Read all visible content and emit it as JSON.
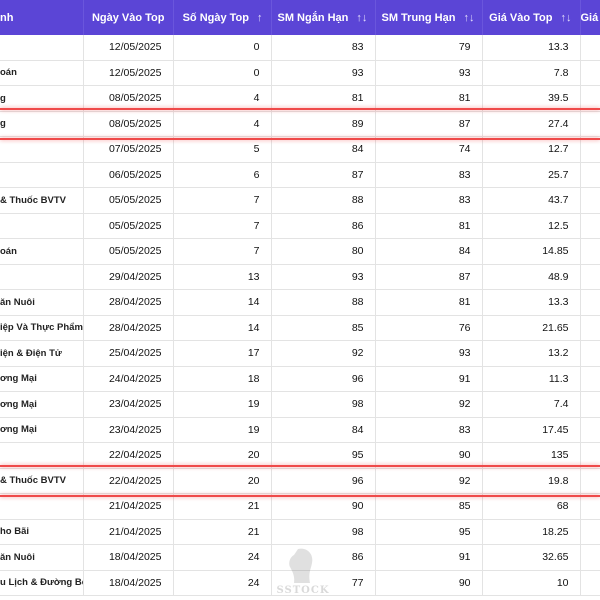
{
  "columns": [
    {
      "label": "nh",
      "sort_icon": ""
    },
    {
      "label": "Ngày Vào Top",
      "sort_icon": ""
    },
    {
      "label": "Số Ngày Top",
      "sort_icon": "↑"
    },
    {
      "label": "SM Ngắn Hạn",
      "sort_icon": "↑↓"
    },
    {
      "label": "SM Trung Hạn",
      "sort_icon": "↑↓"
    },
    {
      "label": "Giá Vào Top",
      "sort_icon": "↑↓"
    },
    {
      "label": "Giá",
      "sort_icon": ""
    }
  ],
  "rows": [
    {
      "industry": "",
      "date": "12/05/2025",
      "days": "0",
      "sm_short": "83",
      "sm_mid": "79",
      "price": "13.3",
      "extra": ""
    },
    {
      "industry": "oán",
      "date": "12/05/2025",
      "days": "0",
      "sm_short": "93",
      "sm_mid": "93",
      "price": "7.8",
      "extra": ""
    },
    {
      "industry": "g",
      "date": "08/05/2025",
      "days": "4",
      "sm_short": "81",
      "sm_mid": "81",
      "price": "39.5",
      "extra": ""
    },
    {
      "industry": "g",
      "date": "08/05/2025",
      "days": "4",
      "sm_short": "89",
      "sm_mid": "87",
      "price": "27.4",
      "extra": ""
    },
    {
      "industry": "",
      "date": "07/05/2025",
      "days": "5",
      "sm_short": "84",
      "sm_mid": "74",
      "price": "12.7",
      "extra": ""
    },
    {
      "industry": "",
      "date": "06/05/2025",
      "days": "6",
      "sm_short": "87",
      "sm_mid": "83",
      "price": "25.7",
      "extra": ""
    },
    {
      "industry": "& Thuốc BVTV",
      "date": "05/05/2025",
      "days": "7",
      "sm_short": "88",
      "sm_mid": "83",
      "price": "43.7",
      "extra": ""
    },
    {
      "industry": "",
      "date": "05/05/2025",
      "days": "7",
      "sm_short": "86",
      "sm_mid": "81",
      "price": "12.5",
      "extra": ""
    },
    {
      "industry": "oán",
      "date": "05/05/2025",
      "days": "7",
      "sm_short": "80",
      "sm_mid": "84",
      "price": "14.85",
      "extra": ""
    },
    {
      "industry": "",
      "date": "29/04/2025",
      "days": "13",
      "sm_short": "93",
      "sm_mid": "87",
      "price": "48.9",
      "extra": ""
    },
    {
      "industry": "ăn Nuôi",
      "date": "28/04/2025",
      "days": "14",
      "sm_short": "88",
      "sm_mid": "81",
      "price": "13.3",
      "extra": ""
    },
    {
      "industry": "iệp Và Thực Phẩm",
      "date": "28/04/2025",
      "days": "14",
      "sm_short": "85",
      "sm_mid": "76",
      "price": "21.65",
      "extra": ""
    },
    {
      "industry": "iện & Điện Tử",
      "date": "25/04/2025",
      "days": "17",
      "sm_short": "92",
      "sm_mid": "93",
      "price": "13.2",
      "extra": ""
    },
    {
      "industry": "ơng Mại",
      "date": "24/04/2025",
      "days": "18",
      "sm_short": "96",
      "sm_mid": "91",
      "price": "11.3",
      "extra": ""
    },
    {
      "industry": "ơng Mại",
      "date": "23/04/2025",
      "days": "19",
      "sm_short": "98",
      "sm_mid": "92",
      "price": "7.4",
      "extra": ""
    },
    {
      "industry": "ơng Mại",
      "date": "23/04/2025",
      "days": "19",
      "sm_short": "84",
      "sm_mid": "83",
      "price": "17.45",
      "extra": ""
    },
    {
      "industry": "",
      "date": "22/04/2025",
      "days": "20",
      "sm_short": "95",
      "sm_mid": "90",
      "price": "135",
      "extra": ""
    },
    {
      "industry": "& Thuốc BVTV",
      "date": "22/04/2025",
      "days": "20",
      "sm_short": "96",
      "sm_mid": "92",
      "price": "19.8",
      "extra": ""
    },
    {
      "industry": "",
      "date": "21/04/2025",
      "days": "21",
      "sm_short": "90",
      "sm_mid": "85",
      "price": "68",
      "extra": ""
    },
    {
      "industry": "ho Bãi",
      "date": "21/04/2025",
      "days": "21",
      "sm_short": "98",
      "sm_mid": "95",
      "price": "18.25",
      "extra": ""
    },
    {
      "industry": "ăn Nuôi",
      "date": "18/04/2025",
      "days": "24",
      "sm_short": "86",
      "sm_mid": "91",
      "price": "32.65",
      "extra": ""
    },
    {
      "industry": "u Lịch & Đường Bộ",
      "date": "18/04/2025",
      "days": "24",
      "sm_short": "77",
      "sm_mid": "90",
      "price": "10",
      "extra": ""
    }
  ],
  "watermark": {
    "text": "SSTOCK"
  },
  "colors": {
    "header_bg": "#5b45d6",
    "highlight": "#ef4a4a"
  },
  "highlight_marks": [
    "row-4-top",
    "row-4-bottom",
    "row-18-top",
    "row-18-bottom"
  ]
}
